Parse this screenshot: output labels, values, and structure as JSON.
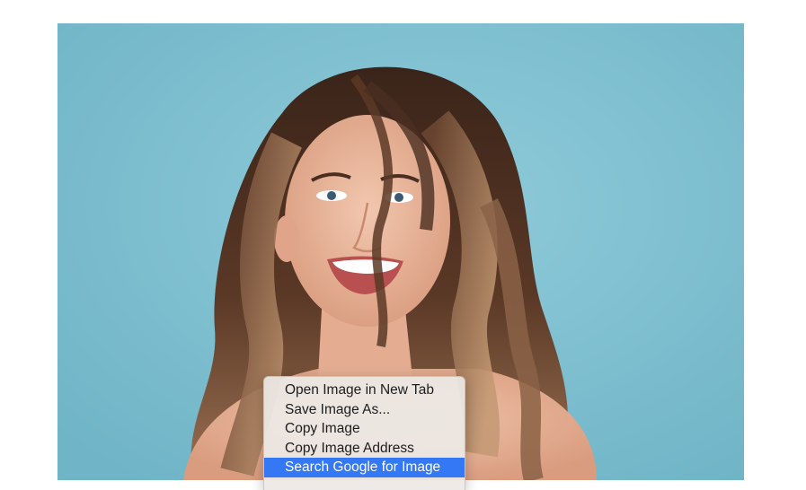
{
  "image": {
    "alt": "photo-of-smiling-woman",
    "background_color": "#7fbfd0"
  },
  "context_menu": {
    "items": [
      {
        "label": "Open Image in New Tab",
        "highlighted": false
      },
      {
        "label": "Save Image As...",
        "highlighted": false
      },
      {
        "label": "Copy Image",
        "highlighted": false
      },
      {
        "label": "Copy Image Address",
        "highlighted": false
      },
      {
        "label": "Search Google for Image",
        "highlighted": true
      }
    ],
    "highlight_color": "#3478f6"
  }
}
